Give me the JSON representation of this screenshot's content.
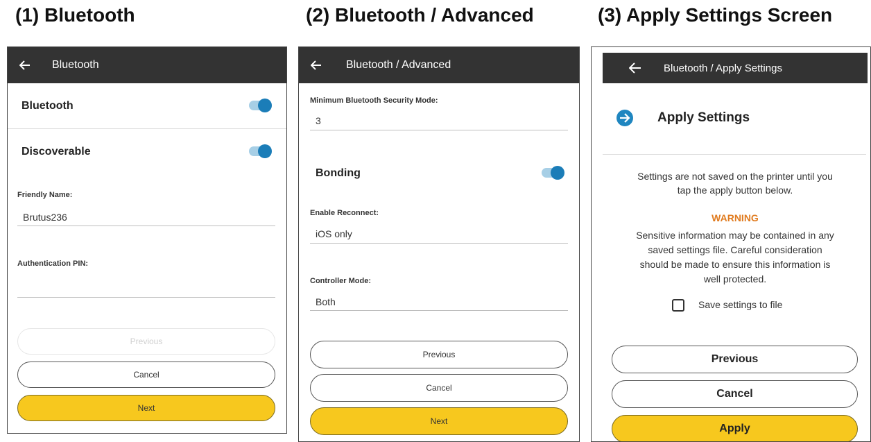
{
  "captions": {
    "c1": "(1) Bluetooth",
    "c2": "(2) Bluetooth / Advanced",
    "c3": "(3) Apply Settings Screen"
  },
  "screen1": {
    "title": "Bluetooth",
    "bluetooth_label": "Bluetooth",
    "bluetooth_on": true,
    "discoverable_label": "Discoverable",
    "discoverable_on": true,
    "friendly_name_label": "Friendly Name:",
    "friendly_name_value": "Brutus236",
    "auth_pin_label": "Authentication PIN:",
    "auth_pin_value": "",
    "previous_label": "Previous",
    "cancel_label": "Cancel",
    "next_label": "Next"
  },
  "screen2": {
    "title": "Bluetooth / Advanced",
    "security_mode_label": "Minimum Bluetooth Security Mode:",
    "security_mode_value": "3",
    "bonding_label": "Bonding",
    "bonding_on": true,
    "reconnect_label": "Enable Reconnect:",
    "reconnect_value": "iOS only",
    "controller_label": "Controller Mode:",
    "controller_value": "Both",
    "previous_label": "Previous",
    "cancel_label": "Cancel",
    "next_label": "Next"
  },
  "screen3": {
    "title": "Bluetooth / Apply Settings",
    "heading": "Apply Settings",
    "info_line1": "Settings are not saved on the printer until you",
    "info_line2": "tap the apply button below.",
    "warning_label": "WARNING",
    "warn_line1": "Sensitive information may be contained in any",
    "warn_line2": "saved settings file. Careful consideration",
    "warn_line3": "should be made to ensure this information is",
    "warn_line4": "well protected.",
    "save_to_file_label": "Save settings to file",
    "save_to_file_checked": false,
    "previous_label": "Previous",
    "cancel_label": "Cancel",
    "apply_label": "Apply"
  },
  "colors": {
    "appbar": "#333333",
    "toggle_on": "#1b7db8",
    "primary_button": "#f7c81e",
    "warning": "#e07b1f",
    "apply_icon": "#1f86c0"
  },
  "icons": {
    "back": "arrow-left-icon",
    "apply": "arrow-right-circle-icon",
    "toggle": "toggle-switch-icon"
  }
}
